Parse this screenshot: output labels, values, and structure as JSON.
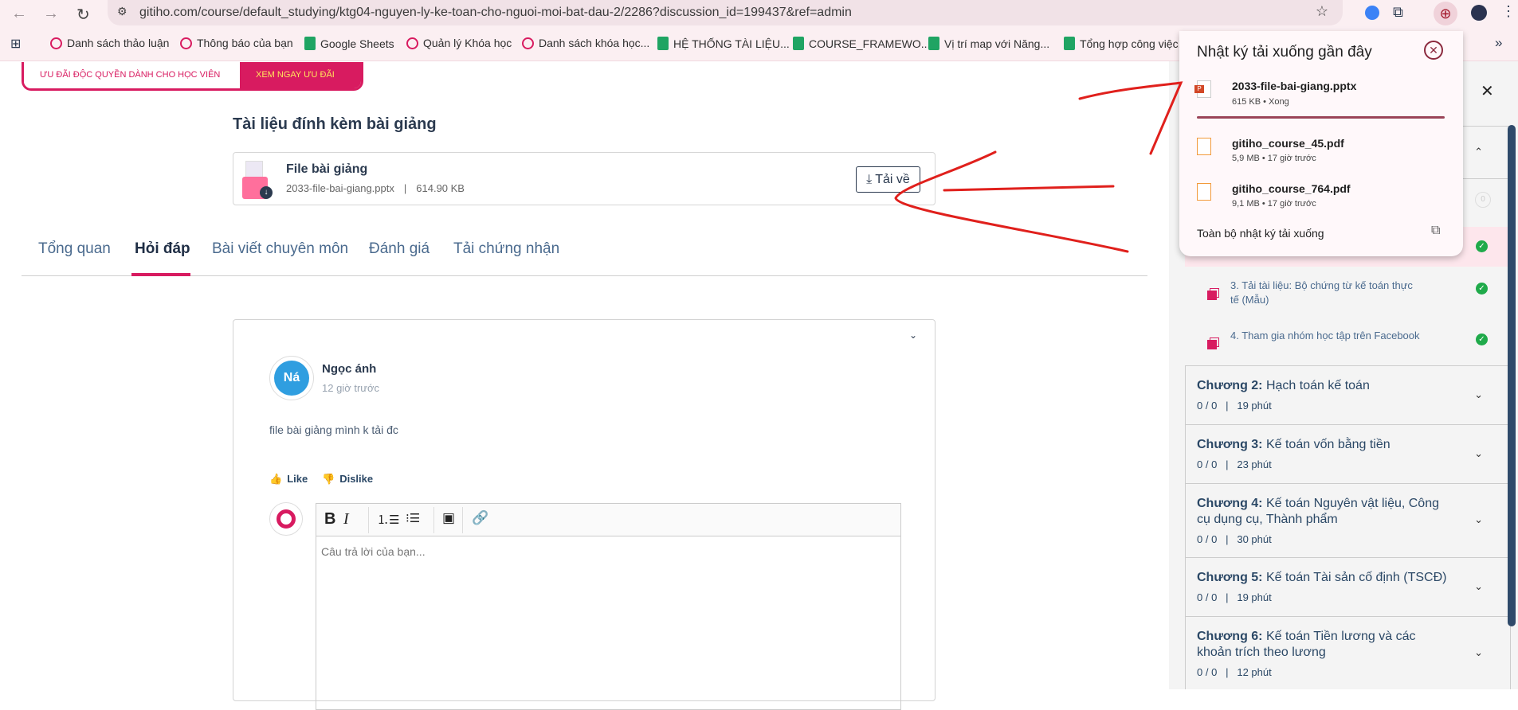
{
  "browser": {
    "url": "gitiho.com/course/default_studying/ktg04-nguyen-ly-ke-toan-cho-nguoi-moi-bat-dau-2/2286?discussion_id=199437&ref=admin",
    "bookmarks": [
      "Danh sách thảo luận",
      "Thông báo của bạn",
      "Google Sheets",
      "Quản lý Khóa học",
      "Danh sách khóa học...",
      "HỆ THỐNG TÀI LIỆU...",
      "COURSE_FRAMEWO...",
      "Vị trí map với Năng...",
      "Tổng hợp công việc..."
    ],
    "more": "»"
  },
  "promo": {
    "text": "ƯU ĐÃI ĐỘC QUYỀN DÀNH CHO HỌC VIÊN",
    "cta": "XEM NGAY ƯU ĐÃI"
  },
  "attachments": {
    "title": "Tài liệu đính kèm bài giảng",
    "file_title": "File bài giảng",
    "file_name": "2033-file-bai-giang.pptx",
    "sep": "|",
    "file_size": "614.90 KB",
    "download": "Tải về"
  },
  "tabs": [
    "Tổng quan",
    "Hỏi đáp",
    "Bài viết chuyên môn",
    "Đánh giá",
    "Tải chứng nhận"
  ],
  "comment": {
    "initials": "Ná",
    "author": "Ngọc ánh",
    "time": "12 giờ trước",
    "text": "file bài giảng mình k tải đc",
    "like": "Like",
    "dislike": "Dislike",
    "placeholder": "Câu trả lời của bạn..."
  },
  "sidebar": {
    "badge": "0",
    "lessons": [
      {
        "title": "3. Tải tài liệu: Bộ chứng từ kế toán thực tế (Mẫu)"
      },
      {
        "title": "4. Tham gia nhóm học tập trên Facebook"
      }
    ],
    "chapters": [
      {
        "label": "Chương 2:",
        "title": "Hạch toán kế toán",
        "meta": "0 / 0   |   19 phút"
      },
      {
        "label": "Chương 3:",
        "title": "Kế toán vốn bằng tiền",
        "meta": "0 / 0   |   23 phút"
      },
      {
        "label": "Chương 4:",
        "title": "Kế toán Nguyên vật liệu, Công cụ dụng cụ, Thành phẩm",
        "meta": "0 / 0   |   30 phút"
      },
      {
        "label": "Chương 5:",
        "title": "Kế toán Tài sản cố định (TSCĐ)",
        "meta": "0 / 0   |   19 phút"
      },
      {
        "label": "Chương 6:",
        "title": "Kế toán Tiền lương và các khoản trích theo lương",
        "meta": "0 / 0   |   12 phút"
      }
    ]
  },
  "downloads": {
    "title": "Nhật ký tải xuống gần đây",
    "items": [
      {
        "name": "2033-file-bai-giang.pptx",
        "meta": "615 KB • Xong",
        "progress": 1.0
      },
      {
        "name": "gitiho_course_45.pdf",
        "meta": "5,9 MB • 17 giờ trước"
      },
      {
        "name": "gitiho_course_764.pdf",
        "meta": "9,1 MB • 17 giờ trước"
      }
    ],
    "footer": "Toàn bộ nhật ký tải xuống"
  },
  "colors": {
    "brand": "#d81b60",
    "annotation": "#e0201c"
  }
}
